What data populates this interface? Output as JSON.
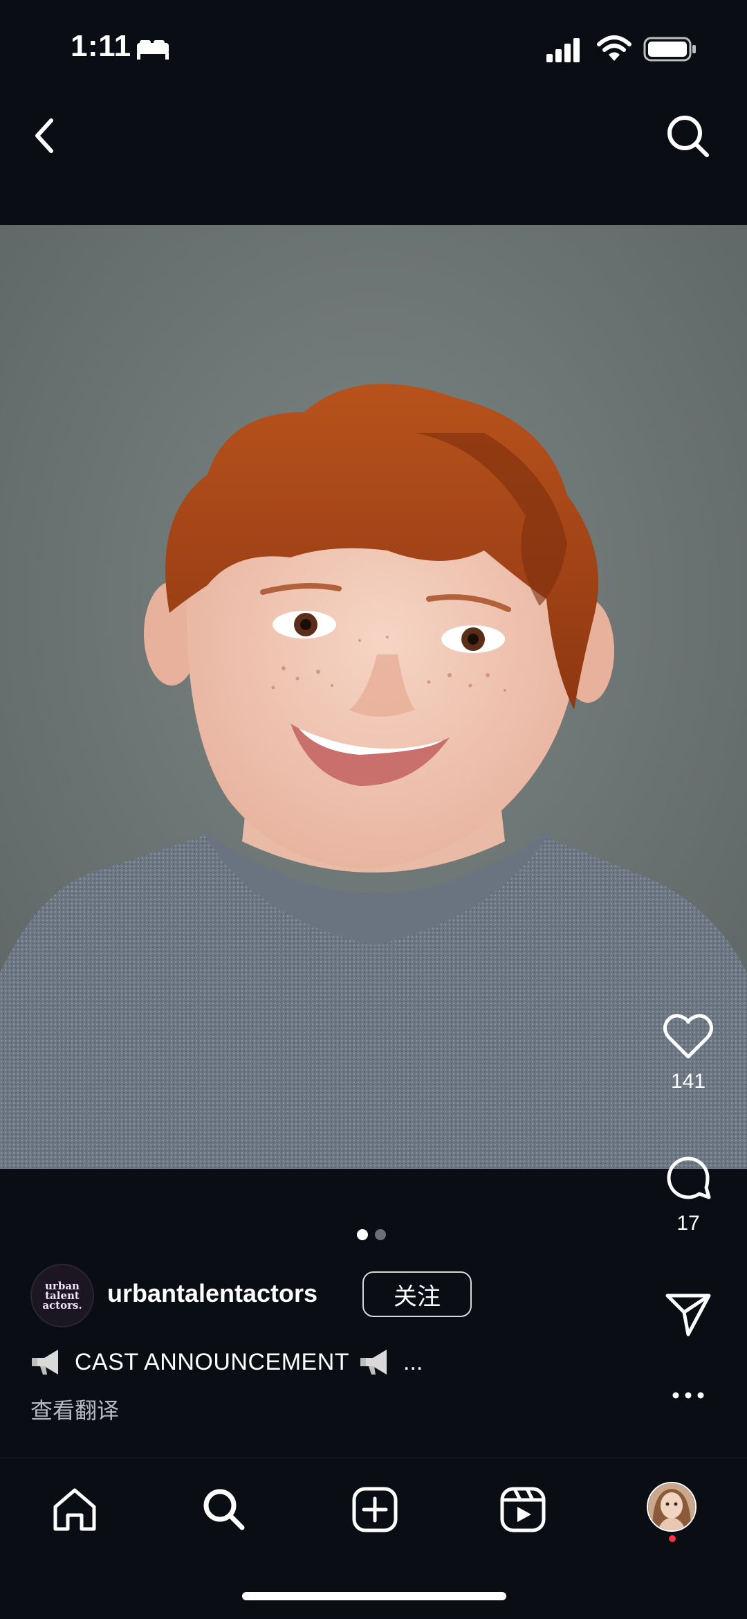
{
  "status_bar": {
    "time": "1:11",
    "icons": [
      "bed-icon",
      "signal-icon",
      "wifi-icon",
      "battery-icon"
    ]
  },
  "header": {
    "back_icon": "chevron-left-icon",
    "search_icon": "search-icon"
  },
  "post": {
    "photo_description": "portrait-photo",
    "pagination": {
      "current": 1,
      "total": 2
    },
    "actions": {
      "likes": "141",
      "comments": "17"
    },
    "account": {
      "avatar_text": "urban talent actors.",
      "username": "urbantalentactors",
      "follow_label": "关注"
    },
    "caption": {
      "text": "CAST ANNOUNCEMENT",
      "ellipsis": "...",
      "translate_label": "查看翻译"
    }
  },
  "nav": {
    "items": [
      "home-icon",
      "search-icon",
      "create-icon",
      "reels-icon",
      "profile-avatar"
    ]
  },
  "colors": {
    "background": "#0a0d14",
    "notification": "#ff3040"
  }
}
